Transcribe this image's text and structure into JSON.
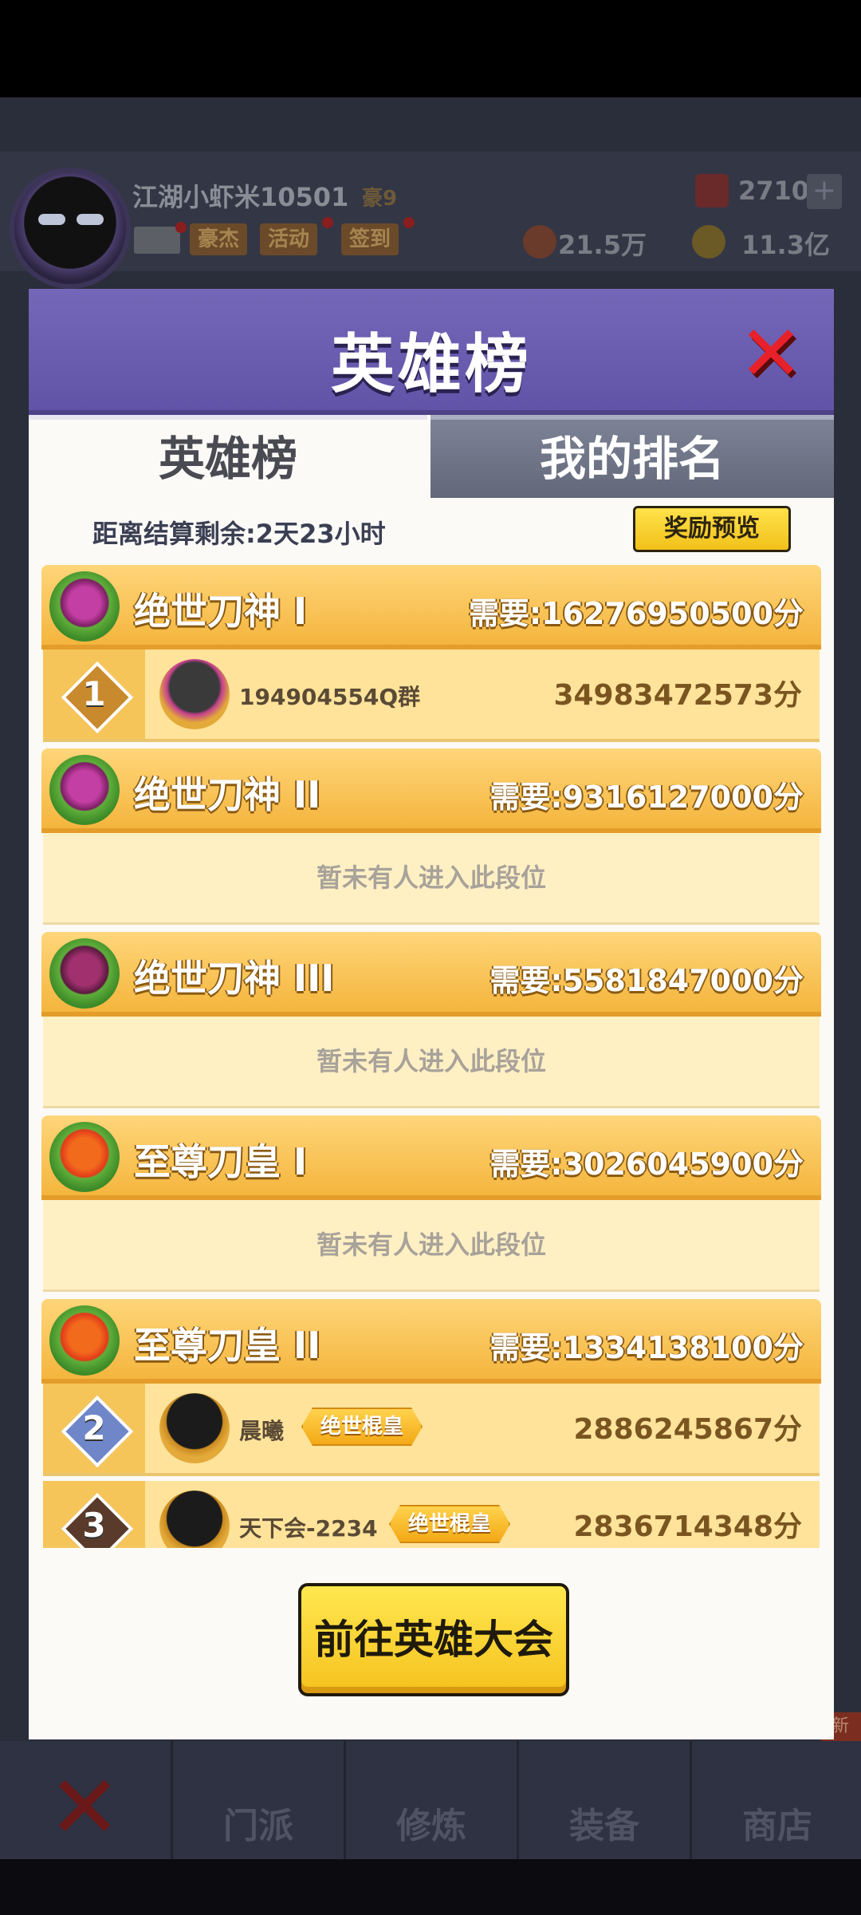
{
  "hud": {
    "player_name": "江湖小虾米10501",
    "vip": "豪9",
    "buttons": [
      "豪杰",
      "活动",
      "签到"
    ],
    "gems": "2710",
    "power": "21.5万",
    "coins": "11.3亿",
    "plus": "+"
  },
  "bottom_nav": {
    "tabs": [
      "门派",
      "修炼",
      "装备",
      "商店"
    ],
    "new_badge": "新"
  },
  "modal": {
    "title": "英雄榜",
    "close": "✕",
    "tabs": [
      "英雄榜",
      "我的排名"
    ],
    "countdown": "距离结算剩余:2天23小时",
    "reward_button": "奖励预览",
    "empty_text": "暂未有人进入此段位",
    "go_button": "前往英雄大会",
    "tiers": [
      {
        "name": "绝世刀神 I",
        "requirement": "需要:16276950500分",
        "players": [
          {
            "rank": "1",
            "name": "194904554Q群",
            "title": "",
            "score": "34983472573分"
          }
        ]
      },
      {
        "name": "绝世刀神 II",
        "requirement": "需要:9316127000分",
        "players": []
      },
      {
        "name": "绝世刀神 III",
        "requirement": "需要:5581847000分",
        "players": []
      },
      {
        "name": "至尊刀皇 I",
        "requirement": "需要:3026045900分",
        "players": []
      },
      {
        "name": "至尊刀皇 II",
        "requirement": "需要:1334138100分",
        "players": [
          {
            "rank": "2",
            "name": "晨曦",
            "title": "绝世棍皇",
            "score": "2886245867分"
          },
          {
            "rank": "3",
            "name": "天下会-2234",
            "title": "绝世棍皇",
            "score": "2836714348分"
          }
        ]
      }
    ]
  }
}
